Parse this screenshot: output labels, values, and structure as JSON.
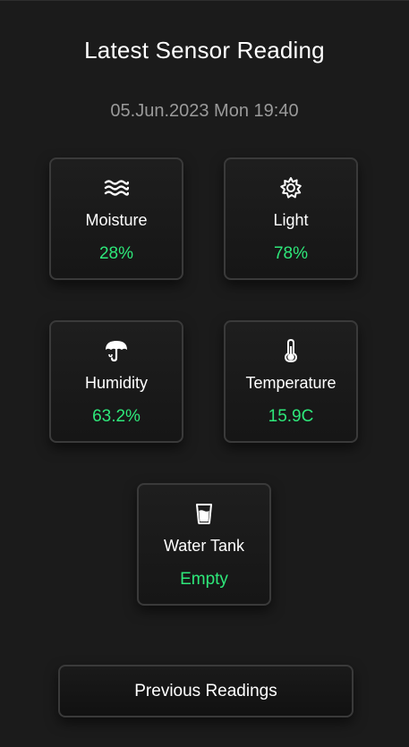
{
  "header": {
    "title": "Latest Sensor Reading",
    "datetime": "05.Jun.2023 Mon 19:40"
  },
  "colors": {
    "background": "#1b1b1b",
    "value_accent": "#2ee87a",
    "muted_text": "#9a9a9a"
  },
  "sensors": [
    {
      "icon": "waves-icon",
      "label": "Moisture",
      "value": "28%"
    },
    {
      "icon": "sun-icon",
      "label": "Light",
      "value": "78%"
    },
    {
      "icon": "umbrella-icon",
      "label": "Humidity",
      "value": "63.2%"
    },
    {
      "icon": "thermometer-icon",
      "label": "Temperature",
      "value": "15.9C"
    },
    {
      "icon": "water-glass-icon",
      "label": "Water Tank",
      "value": "Empty"
    }
  ],
  "actions": {
    "previous_readings_label": "Previous Readings"
  }
}
